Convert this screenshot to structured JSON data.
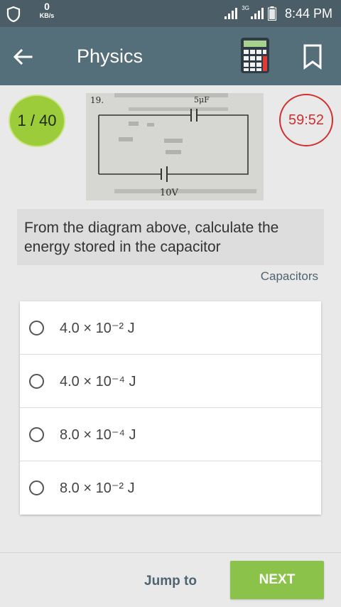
{
  "status_bar": {
    "speed_value": "0",
    "speed_unit": "KB/s",
    "network_type": "3G",
    "time": "8:44 PM"
  },
  "app_bar": {
    "title": "Physics",
    "back_icon": "arrow-left-icon",
    "calculator_icon": "calculator-icon",
    "bookmark_icon": "bookmark-icon"
  },
  "quiz": {
    "counter": "1 / 40",
    "timer": "59:52",
    "question": "From the diagram above, calculate the energy stored in the capacitor",
    "topic": "Capacitors",
    "image": {
      "number": "19.",
      "capacitor_label": "5μF",
      "voltage_label": "10V"
    },
    "options": [
      {
        "label": "4.0 × 10⁻² J"
      },
      {
        "label": "4.0 × 10⁻⁴ J"
      },
      {
        "label": "8.0 × 10⁻⁴ J"
      },
      {
        "label": "8.0 × 10⁻² J"
      }
    ]
  },
  "footer": {
    "jump_label": "Jump to",
    "next_label": "NEXT"
  },
  "colors": {
    "app_bar": "#546e7a",
    "status_bar": "#4b5d67",
    "counter_bg": "#9ccc3a",
    "timer": "#d32f2f",
    "next_button": "#8bc34a"
  }
}
